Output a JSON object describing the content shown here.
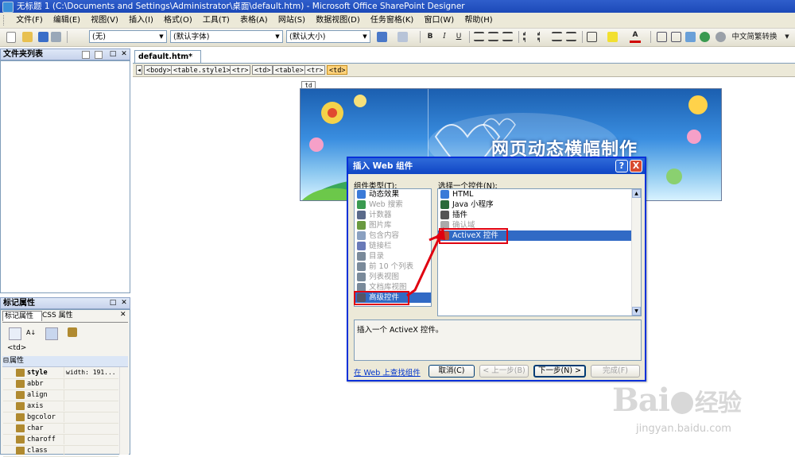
{
  "window": {
    "title": "无标题 1 (C:\\Documents and Settings\\Administrator\\桌面\\default.htm) - Microsoft Office SharePoint Designer"
  },
  "menu": [
    "文件(F)",
    "编辑(E)",
    "视图(V)",
    "插入(I)",
    "格式(O)",
    "工具(T)",
    "表格(A)",
    "网站(S)",
    "数据视图(D)",
    "任务窗格(K)",
    "窗口(W)",
    "帮助(H)"
  ],
  "toolbar": {
    "style_value": "(无)",
    "font_value": "(默认字体)",
    "size_value": "(默认大小)",
    "bold": "B",
    "italic": "I",
    "underline": "U",
    "font_color": "A",
    "convert_label": "中文简繁转换"
  },
  "folder_panel": {
    "title": "文件夹列表"
  },
  "tag_panel": {
    "title": "标记属性",
    "tabs": [
      "标记属性",
      "CSS 属性"
    ],
    "current_tag": "<td>",
    "section": "属性",
    "properties": [
      {
        "name": "style",
        "value": "width: 191..."
      },
      {
        "name": "abbr",
        "value": ""
      },
      {
        "name": "align",
        "value": ""
      },
      {
        "name": "axis",
        "value": ""
      },
      {
        "name": "bgcolor",
        "value": ""
      },
      {
        "name": "char",
        "value": ""
      },
      {
        "name": "charoff",
        "value": ""
      },
      {
        "name": "class",
        "value": ""
      }
    ]
  },
  "editor": {
    "doc_tab": "default.htm*",
    "breadcrumb": [
      "<body>",
      "<table.style1>",
      "<tr>",
      "<td>",
      "<table>",
      "<tr>",
      "<td>"
    ],
    "cell_tag": "td",
    "banner_title": "网页动态横幅制作"
  },
  "dialog": {
    "title": "插入 Web 组件",
    "help_button": "?",
    "close_button": "X",
    "categories_label": "组件类型(T):",
    "categories": [
      {
        "label": "动态效果",
        "disabled": false,
        "selected": false
      },
      {
        "label": "Web 搜索",
        "disabled": true,
        "selected": false
      },
      {
        "label": "计数器",
        "disabled": true,
        "selected": false
      },
      {
        "label": "图片库",
        "disabled": true,
        "selected": false
      },
      {
        "label": "包含内容",
        "disabled": true,
        "selected": false
      },
      {
        "label": "链接栏",
        "disabled": true,
        "selected": false
      },
      {
        "label": "目录",
        "disabled": true,
        "selected": false
      },
      {
        "label": "前 10 个列表",
        "disabled": true,
        "selected": false
      },
      {
        "label": "列表视图",
        "disabled": true,
        "selected": false
      },
      {
        "label": "文档库视图",
        "disabled": true,
        "selected": false
      },
      {
        "label": "高级控件",
        "disabled": false,
        "selected": true
      }
    ],
    "controls_label": "选择一个控件(N):",
    "controls": [
      {
        "label": "HTML",
        "disabled": false,
        "selected": false
      },
      {
        "label": "Java 小程序",
        "disabled": false,
        "selected": false
      },
      {
        "label": "插件",
        "disabled": false,
        "selected": false
      },
      {
        "label": "确认域",
        "disabled": true,
        "selected": false
      },
      {
        "label": "ActiveX 控件",
        "disabled": false,
        "selected": true
      }
    ],
    "description": "插入一个 ActiveX 控件。",
    "web_link": "在 Web 上查找组件",
    "buttons": {
      "cancel": "取消(C)",
      "back": "< 上一步(B)",
      "next": "下一步(N) >",
      "finish": "完成(F)"
    }
  },
  "watermark": {
    "brand": "Bai",
    "brand_suffix": "经验",
    "url": "jingyan.baidu.com"
  },
  "colors": {
    "title_blue": "#1c49b8",
    "selection": "#316ac5",
    "highlight_red": "#e00010"
  }
}
